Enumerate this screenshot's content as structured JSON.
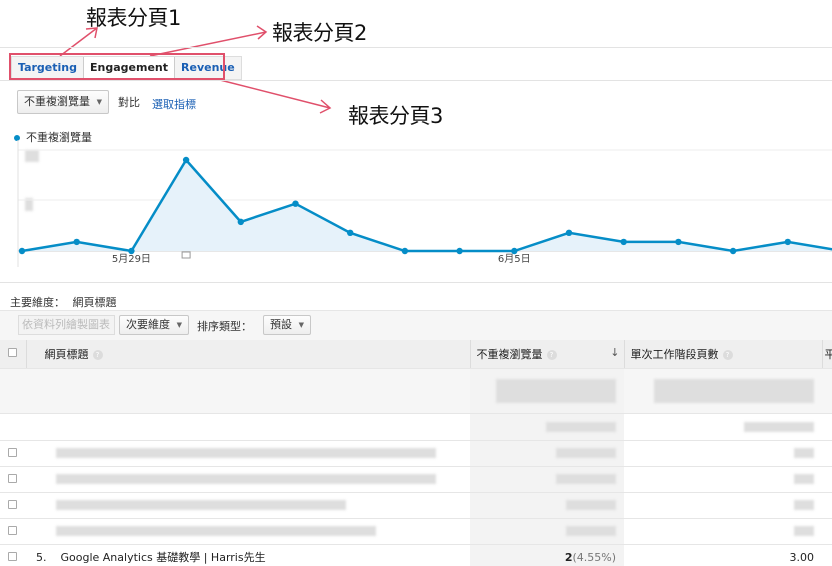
{
  "annotations": {
    "label1": "報表分頁1",
    "label2": "報表分頁2",
    "label3": "報表分頁3"
  },
  "tabs": [
    {
      "label": "Targeting",
      "active": false
    },
    {
      "label": "Engagement",
      "active": true
    },
    {
      "label": "Revenue",
      "active": false
    }
  ],
  "metric_selector": {
    "value": "不重複瀏覽量",
    "compare_label": "對比",
    "select_metric_link": "選取指標"
  },
  "chart_data": {
    "type": "line",
    "series": [
      {
        "name": "不重複瀏覽量",
        "values": [
          0,
          0.25,
          0,
          2.5,
          0.8,
          1.3,
          0.5,
          0,
          0,
          0,
          0.5,
          0.25,
          0.25,
          0,
          0.25,
          0
        ]
      }
    ],
    "x_tick_labels": [
      "5月29日",
      "6月5日"
    ],
    "x_tick_index": [
      2,
      9
    ],
    "ylim": [
      0,
      2.5
    ],
    "colors": {
      "line": "#058dc7",
      "fill": "#e6f2fa"
    }
  },
  "table": {
    "primary_dimension_label": "主要維度：",
    "primary_dimension_value": "網頁標題",
    "toolbar": {
      "plot_rows_button": "依資料列繪製圖表",
      "secondary_dimension": "次要維度",
      "sort_type_label": "排序類型：",
      "sort_type_value": "預設"
    },
    "headers": {
      "title": "網頁標題",
      "unique_pageviews": "不重複瀏覽量",
      "pages_per_session": "單次工作階段頁數",
      "next": "平"
    },
    "visible_row": {
      "index": "5.",
      "title": "Google Analytics 基礎教學 | Harris先生",
      "unique_pageviews": "2",
      "unique_pageviews_pct": "(4.55%)",
      "pages_per_session": "3.00"
    }
  }
}
